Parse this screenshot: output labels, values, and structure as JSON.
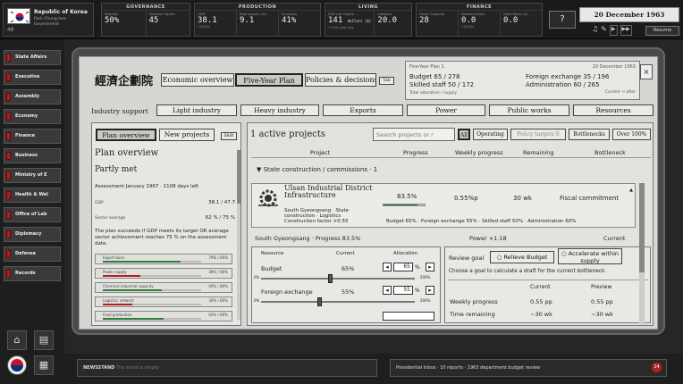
{
  "country": {
    "name": "Republic of Korea",
    "leader": "Park Chung-hee",
    "role": "Government"
  },
  "topbar": {
    "governance": {
      "title": "GOVERNANCE",
      "stability_label": "Stability",
      "stability": "50%",
      "capital_label": "Political Capital",
      "capital": "45"
    },
    "production": {
      "title": "PRODUCTION",
      "gdp_label": "GDP",
      "gdp": "38.1",
      "gdp_sub": "+$1B/M",
      "growth_label": "Real growth (%)",
      "growth": "9.1",
      "industry_label": "Economy",
      "industry": "41%"
    },
    "living": {
      "title": "LIVING",
      "percap_label": "GDP per Capita",
      "percap": "141",
      "percap_unit": "dollars ($)",
      "percap_sub": "+3.9% year avg.",
      "inflation_label": "Inflation",
      "inflation": "20.0"
    },
    "finance": {
      "title": "FINANCE",
      "fiscal_label": "Fiscal Capacity",
      "fiscal": "28",
      "debt_label": "National Debt",
      "debt": "0.0",
      "debt_sub": "+$1B/M",
      "ratio_label": "Debt Ratio (%)",
      "ratio": "0.0"
    },
    "date": "20 December 1963",
    "help": "?",
    "resume": "Resume"
  },
  "sidebar": {
    "items": [
      "State Affairs",
      "Executive",
      "Assembly",
      "Economy",
      "Finance",
      "Business",
      "Ministry of E",
      "Health & Wel",
      "Office of Lab",
      "Diplomacy",
      "Defense",
      "Records"
    ]
  },
  "header": {
    "title_kr": "經濟企劃院",
    "tabs": [
      "Economic overview",
      "Five-Year Plan",
      "Policies & decisions"
    ],
    "tab_hint": "Tab",
    "plan_box": {
      "title": "Five-Year Plan 1",
      "date": "20 December 1963",
      "budget": "Budget  65 / 278",
      "staff": "Skilled staff  50 / 172",
      "total": "Total allocation / supply",
      "fx": "Foreign exchange  35 / 196",
      "admin": "Administration  60 / 265",
      "note": "Current → after"
    }
  },
  "support": {
    "label": "Industry support",
    "items": [
      "Light industry",
      "Heavy industry",
      "Exports",
      "Power",
      "Public works",
      "Resources"
    ]
  },
  "left": {
    "tabs": [
      "Plan overview",
      "New projects"
    ],
    "shift": "Shift",
    "title": "Plan overview",
    "status": "Partly met",
    "assess": "Assessment January 1967 · 1108 days left",
    "gdp_label": "GDP",
    "gdp_val": "38.1 / 47.7",
    "sector_label": "Sector average",
    "sector_val": "62 % / 75 %",
    "desc": "The plan succeeds if GDP meets its target OR average sector achievement reaches 75 % on the assessment date.",
    "bars": [
      {
        "name": "Export base",
        "val": "79% / 80%",
        "pct": 0.79
      },
      {
        "name": "Power supply",
        "val": "38% / 80%",
        "pct": 0.38
      },
      {
        "name": "Chemical industrial capacity",
        "val": "60% / 80%",
        "pct": 0.6
      },
      {
        "name": "Logistics network",
        "val": "30% / 80%",
        "pct": 0.3
      },
      {
        "name": "Food production",
        "val": "62% / 80%",
        "pct": 0.62
      }
    ]
  },
  "right": {
    "active": "1 active projects",
    "search_placeholder": "Search projects or r",
    "filters": [
      "All",
      "Operating",
      "Policy targets 0",
      "Bottlenecks",
      "Over 100%"
    ],
    "cols": [
      "Project",
      "Progress",
      "Weekly progress",
      "Remaining",
      "Bottleneck"
    ],
    "group": "State construction / commissions · 1",
    "project": {
      "name": "Ulsan Industrial District Infrastructure",
      "region": "South Gyeongsang · State construction · Logistics",
      "factor": "Construction factor ×0.55",
      "progress": "83.5%",
      "progress_pct": 0.835,
      "weekly": "0.55%p",
      "remaining": "30 wk",
      "bottleneck": "Fiscal commitment",
      "shares": "Budget 65% · Foreign exchange 55% · Skilled staff 50% · Administration 60%"
    },
    "detail": {
      "loc": "South Gyeongsang · Progress 83.5%",
      "power": "Power ×1.18",
      "current": "Current",
      "res_cols": [
        "Resource",
        "Current",
        "Allocation"
      ],
      "resources": [
        {
          "name": "Budget",
          "cur": "65%",
          "alloc": "65",
          "pos": 0.45
        },
        {
          "name": "Foreign exchange",
          "cur": "55%",
          "alloc": "55",
          "pos": 0.38
        }
      ],
      "scale_min": "0%",
      "scale_max": "200%",
      "review_label": "Review goal",
      "relieve": "Relieve Budget",
      "accelerate": "Accelerate within supply",
      "hint": "Choose a goal to calculate a draft for the current bottleneck.",
      "cmp_cols": [
        "Current",
        "Preview"
      ],
      "cmp": [
        {
          "name": "Weekly progress",
          "cur": "0.55 pp",
          "pre": "0.55 pp"
        },
        {
          "name": "Time remaining",
          "cur": "~30 wk",
          "pre": "~30 wk"
        }
      ]
    }
  },
  "bottom": {
    "newsstand": "NEWSSTAND",
    "news_sub": "The stand is empty",
    "briefing": "Presidential Inbox · 10 reports · 1963 department budget review",
    "badge": "14"
  },
  "colors": {
    "green": "#2f7a3c",
    "red": "#b02020"
  }
}
